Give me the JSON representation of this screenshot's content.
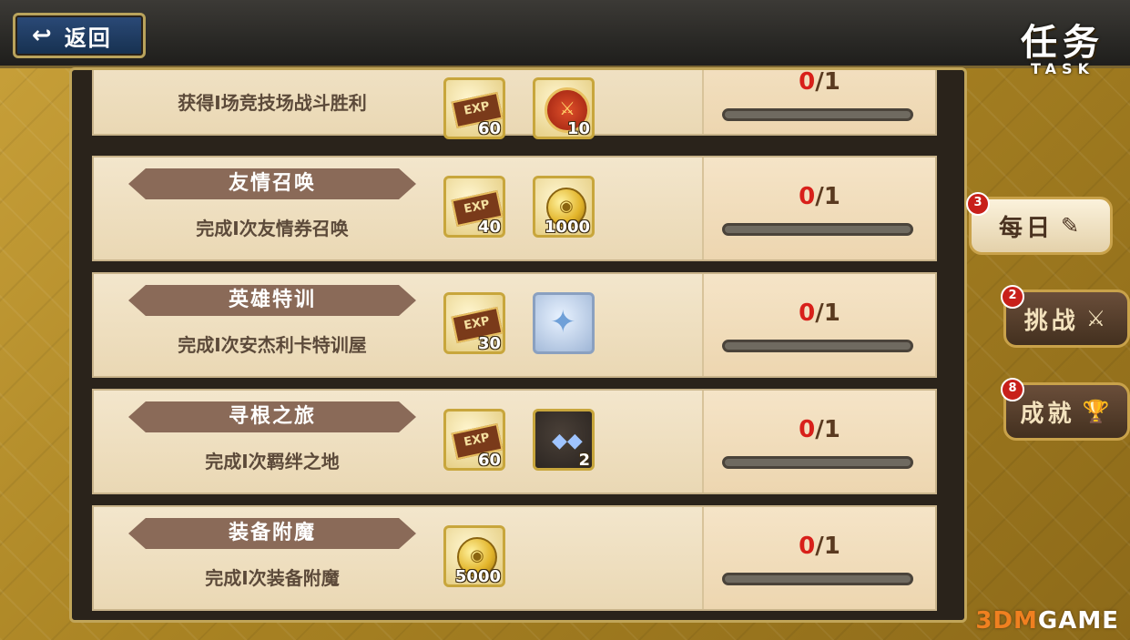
{
  "header": {
    "back_label": "返回",
    "title": "任务",
    "title_en": "TASK"
  },
  "tasks": [
    {
      "title": "",
      "desc": "获得Ⅰ场竞技场战斗胜利",
      "progress": "0/1",
      "progress_done": "0",
      "progress_total": "/1",
      "rewards": [
        {
          "icon": "exp-icon",
          "count": "60"
        },
        {
          "icon": "arena-medal-icon",
          "count": "10"
        }
      ]
    },
    {
      "title": "友情召唤",
      "desc": "完成Ⅰ次友情券召唤",
      "progress": "0/1",
      "progress_done": "0",
      "progress_total": "/1",
      "rewards": [
        {
          "icon": "exp-icon",
          "count": "40"
        },
        {
          "icon": "gold-coin-icon",
          "count": "1000"
        }
      ]
    },
    {
      "title": "英雄特训",
      "desc": "完成Ⅰ次安杰利卡特训屋",
      "progress": "0/1",
      "progress_done": "0",
      "progress_total": "/1",
      "rewards": [
        {
          "icon": "exp-icon",
          "count": "30"
        },
        {
          "icon": "crystal-shard-icon",
          "count": ""
        }
      ]
    },
    {
      "title": "寻根之旅",
      "desc": "完成Ⅰ次羁绊之地",
      "progress": "0/1",
      "progress_done": "0",
      "progress_total": "/1",
      "rewards": [
        {
          "icon": "exp-icon",
          "count": "60"
        },
        {
          "icon": "gems-icon",
          "count": "2"
        }
      ]
    },
    {
      "title": "装备附魔",
      "desc": "完成Ⅰ次装备附魔",
      "progress": "0/1",
      "progress_done": "0",
      "progress_total": "/1",
      "rewards": [
        {
          "icon": "gold-coin-icon",
          "count": "5000"
        }
      ]
    }
  ],
  "tabs": [
    {
      "label": "每日",
      "badge": "3",
      "active": true
    },
    {
      "label": "挑战",
      "badge": "2",
      "active": false
    },
    {
      "label": "成就",
      "badge": "8",
      "active": false
    }
  ],
  "reward_labels": {
    "exp": "EXP"
  },
  "watermark": {
    "prefix": "3DM",
    "suffix": "GAME"
  },
  "colors": {
    "accent": "#c9a24a",
    "progress_done": "#d8201a",
    "ribbon": "#8a6a58"
  }
}
